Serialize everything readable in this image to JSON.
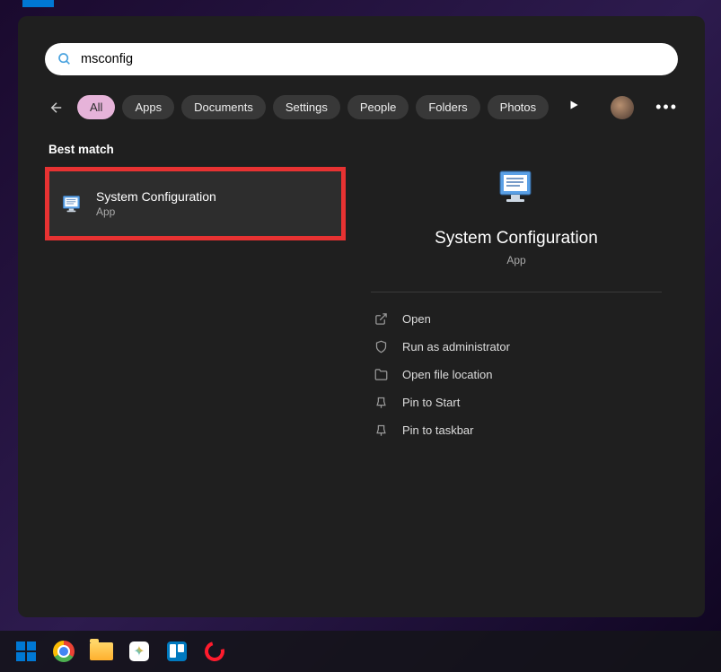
{
  "search": {
    "query": "msconfig"
  },
  "filters": {
    "items": [
      {
        "label": "All",
        "active": true
      },
      {
        "label": "Apps",
        "active": false
      },
      {
        "label": "Documents",
        "active": false
      },
      {
        "label": "Settings",
        "active": false
      },
      {
        "label": "People",
        "active": false
      },
      {
        "label": "Folders",
        "active": false
      },
      {
        "label": "Photos",
        "active": false
      }
    ]
  },
  "sections": {
    "best_match": "Best match"
  },
  "result": {
    "title": "System Configuration",
    "subtitle": "App"
  },
  "preview": {
    "title": "System Configuration",
    "subtitle": "App",
    "actions": [
      {
        "label": "Open",
        "icon": "open"
      },
      {
        "label": "Run as administrator",
        "icon": "shield"
      },
      {
        "label": "Open file location",
        "icon": "folder"
      },
      {
        "label": "Pin to Start",
        "icon": "pin"
      },
      {
        "label": "Pin to taskbar",
        "icon": "pin"
      }
    ]
  }
}
